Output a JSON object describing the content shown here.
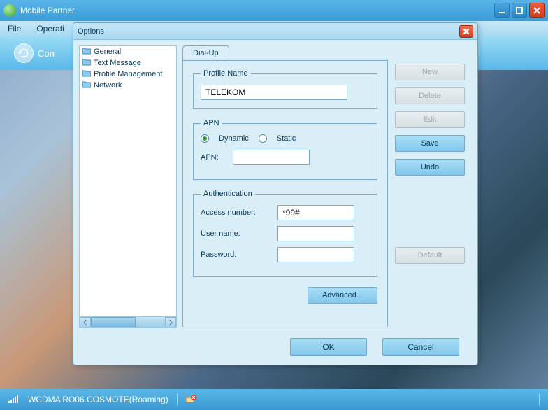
{
  "window": {
    "title": "Mobile Partner"
  },
  "menubar": {
    "file": "File",
    "operation": "Operati"
  },
  "toolbar": {
    "connect": "Con"
  },
  "status": {
    "network": "WCDMA  RO06 COSMOTE(Roaming)"
  },
  "dialog": {
    "title": "Options",
    "tree": {
      "items": [
        "General",
        "Text Message",
        "Profile Management",
        "Network"
      ],
      "selected": 2
    },
    "tab": {
      "label": "Dial-Up"
    },
    "profile": {
      "legend": "Profile Name",
      "value": "TELEKOM"
    },
    "apn": {
      "legend": "APN",
      "dynamic": "Dynamic",
      "static": "Static",
      "label": "APN:",
      "value": ""
    },
    "auth": {
      "legend": "Authentication",
      "access_label": "Access number:",
      "access_value": "*99#",
      "user_label": "User name:",
      "user_value": "",
      "pass_label": "Password:",
      "pass_value": ""
    },
    "advanced": "Advanced...",
    "side": {
      "new": "New",
      "delete": "Delete",
      "edit": "Edit",
      "save": "Save",
      "undo": "Undo",
      "default": "Default"
    },
    "footer": {
      "ok": "OK",
      "cancel": "Cancel"
    }
  }
}
